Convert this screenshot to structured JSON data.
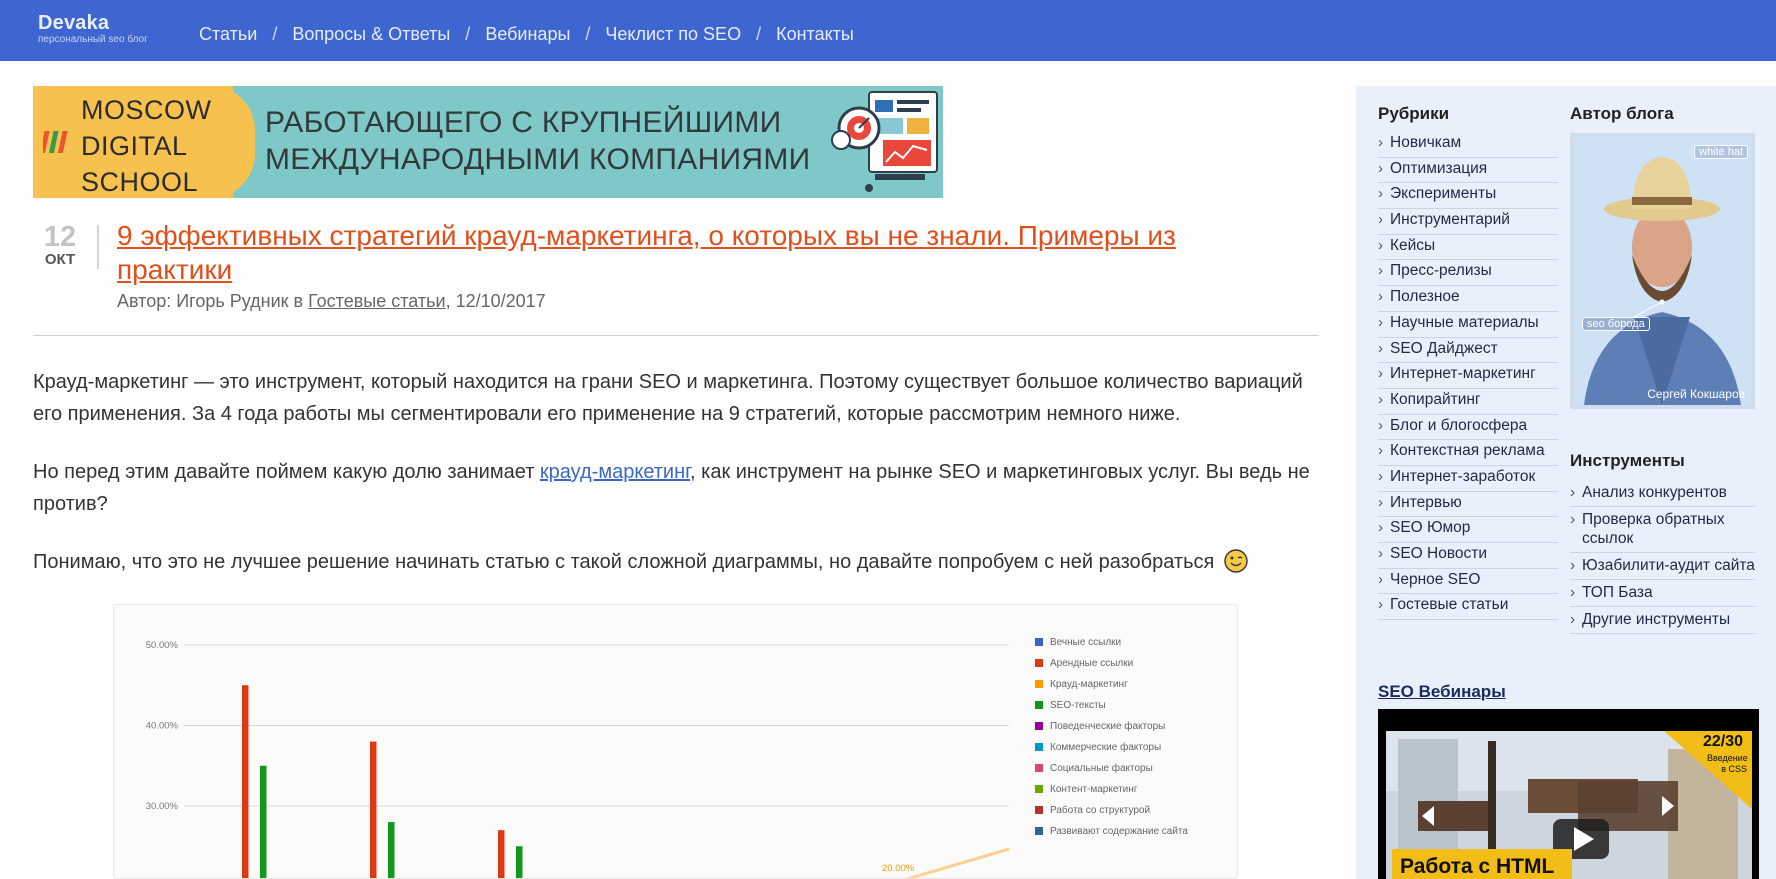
{
  "header": {
    "logo_title": "Devaka",
    "logo_subtitle": "персональный seo блог",
    "nav": [
      "Статьи",
      "Вопросы & Ответы",
      "Вебинары",
      "Чеклист по SEO",
      "Контакты"
    ],
    "separator": "/"
  },
  "banner": {
    "logo_lines": [
      "MOSCOW",
      "DIGITAL",
      "SCHOOL"
    ],
    "text_lines": [
      "РАБОТАЮЩЕГО С КРУПНЕЙШИМИ",
      "МЕЖДУНАРОДНЫМИ КОМПАНИЯМИ"
    ]
  },
  "post": {
    "day": "12",
    "month": "ОКТ",
    "title": "9 эффективных стратегий крауд-маркетинга, о которых вы не знали. Примеры из практики",
    "meta_prefix": "Автор: Игорь Рудник в",
    "meta_category": "Гостевые статьи",
    "meta_date": ", 12/10/2017",
    "p1": "Крауд-маркетинг — это инструмент, который находится на грани SEO и маркетинга. Поэтому существует большое количество вариаций его применения. За 4 года работы мы сегментировали его применение на 9 стратегий, которые рассмотрим немного ниже.",
    "p2_before": "Но перед этим давайте поймем какую долю занимает ",
    "p2_link": "крауд-маркетинг",
    "p2_after": ", как инструмент на рынке SEO и маркетинговых услуг. Вы ведь не против?",
    "p3": "Понимаю, что это не лучшее решение начинать статью с такой сложной диаграммы, но давайте попробуем с ней разобраться"
  },
  "chart_data": {
    "type": "bar",
    "y_ticks": [
      "50.00%",
      "40.00%",
      "30.00%"
    ],
    "ylim": [
      25,
      50
    ],
    "series": [
      {
        "name": "Вечные ссылки",
        "color": "#3a64c8"
      },
      {
        "name": "Арендные ссылки",
        "color": "#dc3912"
      },
      {
        "name": "Крауд-маркетинг",
        "color": "#ff9900"
      },
      {
        "name": "SEO-тексты",
        "color": "#109618"
      },
      {
        "name": "Поведенческие факторы",
        "color": "#990099"
      },
      {
        "name": "Коммерческие факторы",
        "color": "#0099c6"
      },
      {
        "name": "Социальные факторы",
        "color": "#dd4477"
      },
      {
        "name": "Контент-маркетинг",
        "color": "#66aa00"
      },
      {
        "name": "Работа со структурой",
        "color": "#b82e2e"
      },
      {
        "name": "Развивают содержание сайта",
        "color": "#316395"
      }
    ],
    "bars": [
      {
        "series": "Арендные ссылки",
        "group": 0,
        "value": 45
      },
      {
        "series": "SEO-тексты",
        "group": 0,
        "value": 35
      },
      {
        "series": "Арендные ссылки",
        "group": 1,
        "value": 38
      },
      {
        "series": "SEO-тексты",
        "group": 1,
        "value": 28
      },
      {
        "series": "Арендные ссылки",
        "group": 2,
        "value": 27
      },
      {
        "series": "SEO-тексты",
        "group": 2,
        "value": 25
      }
    ],
    "annotation": "20.00%"
  },
  "sidebar": {
    "rubrics_title": "Рубрики",
    "rubrics": [
      "Новичкам",
      "Оптимизация",
      "Эксперименты",
      "Инструментарий",
      "Кейсы",
      "Пресс-релизы",
      "Полезное",
      "Научные материалы",
      "SEO Дайджест",
      "Интернет-маркетинг",
      "Копирайтинг",
      "Блог и блогосфера",
      "Контекстная реклама",
      "Интернет-заработок",
      "Интервью",
      "SEO Юмор",
      "SEO Новости",
      "Черное SEO",
      "Гостевые статьи"
    ],
    "author_title": "Автор блога",
    "author_tag_top": "white hat",
    "author_tag_bottom": "seo борода",
    "author_name": "Сергей Кокшаров",
    "tools_title": "Инструменты",
    "tools": [
      "Анализ конкурентов",
      "Проверка обратных ссылок",
      "Юзабилити-аудит сайта",
      "ТОП База",
      "Другие инструменты"
    ],
    "webinars_title": "SEO Вебинары",
    "video_counter": "22/30",
    "video_badge": "Введение в CSS",
    "video_caption": "Работа с HTML"
  }
}
